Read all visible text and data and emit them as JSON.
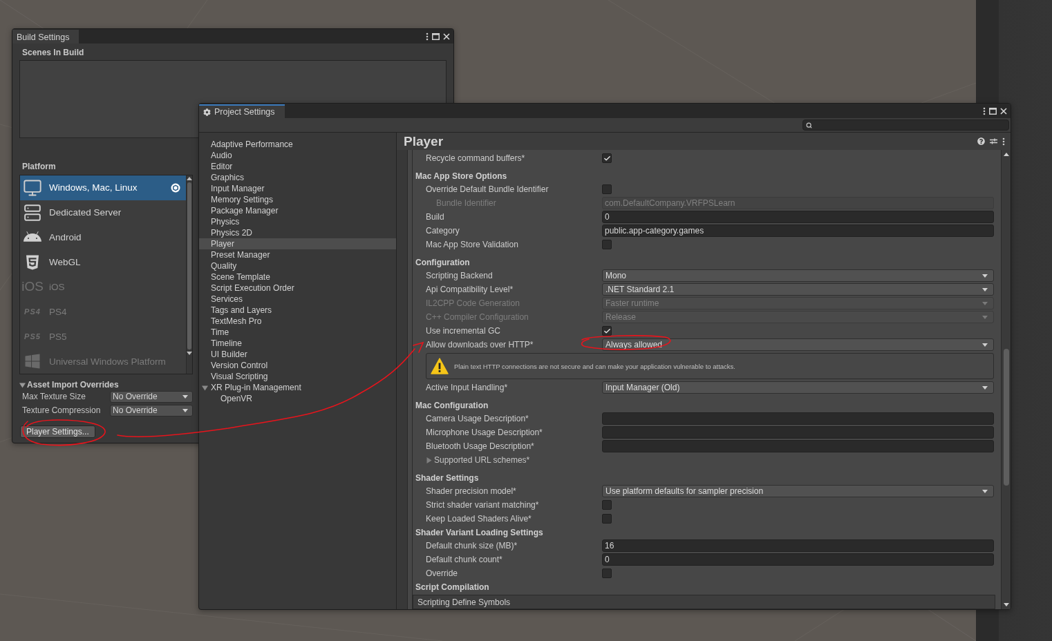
{
  "build_settings": {
    "title": "Build Settings",
    "scenes_label": "Scenes In Build",
    "platform_label": "Platform",
    "platforms": [
      {
        "kind": "desktop",
        "name": "Windows, Mac, Linux",
        "selected": true,
        "disabled": false
      },
      {
        "kind": "server",
        "name": "Dedicated Server",
        "selected": false,
        "disabled": false
      },
      {
        "kind": "android",
        "name": "Android",
        "selected": false,
        "disabled": false
      },
      {
        "kind": "webgl",
        "name": "WebGL",
        "selected": false,
        "disabled": false
      },
      {
        "kind": "ios",
        "logo": "iOS",
        "name": "iOS",
        "selected": false,
        "disabled": true
      },
      {
        "kind": "ps4",
        "logo": "PS4",
        "name": "PS4",
        "selected": false,
        "disabled": true
      },
      {
        "kind": "ps5",
        "logo": "PS5",
        "name": "PS5",
        "selected": false,
        "disabled": true
      },
      {
        "kind": "uwp",
        "name": "Universal Windows Platform",
        "selected": false,
        "disabled": true
      }
    ],
    "asset_import_overrides": {
      "label": "Asset Import Overrides",
      "expanded": true,
      "rows": [
        {
          "label": "Max Texture Size",
          "value": "No Override"
        },
        {
          "label": "Texture Compression",
          "value": "No Override"
        }
      ]
    },
    "player_settings_button": "Player Settings..."
  },
  "project_settings": {
    "title": "Project Settings",
    "nav": [
      {
        "label": "Adaptive Performance",
        "selected": false
      },
      {
        "label": "Audio",
        "selected": false
      },
      {
        "label": "Editor",
        "selected": false
      },
      {
        "label": "Graphics",
        "selected": false
      },
      {
        "label": "Input Manager",
        "selected": false
      },
      {
        "label": "Memory Settings",
        "selected": false
      },
      {
        "label": "Package Manager",
        "selected": false
      },
      {
        "label": "Physics",
        "selected": false
      },
      {
        "label": "Physics 2D",
        "selected": false
      },
      {
        "label": "Player",
        "selected": true
      },
      {
        "label": "Preset Manager",
        "selected": false
      },
      {
        "label": "Quality",
        "selected": false
      },
      {
        "label": "Scene Template",
        "selected": false
      },
      {
        "label": "Script Execution Order",
        "selected": false
      },
      {
        "label": "Services",
        "selected": false
      },
      {
        "label": "Tags and Layers",
        "selected": false
      },
      {
        "label": "TextMesh Pro",
        "selected": false
      },
      {
        "label": "Time",
        "selected": false
      },
      {
        "label": "Timeline",
        "selected": false
      },
      {
        "label": "UI Builder",
        "selected": false
      },
      {
        "label": "Version Control",
        "selected": false
      },
      {
        "label": "Visual Scripting",
        "selected": false
      },
      {
        "label": "XR Plug-in Management",
        "selected": false,
        "expanded": true,
        "children": [
          {
            "label": "OpenVR",
            "selected": false
          }
        ]
      }
    ],
    "panel_title": "Player",
    "rows": [
      {
        "kind": "checkbox",
        "label": "Recycle command buffers*",
        "checked": true
      },
      {
        "kind": "header",
        "label": "Mac App Store Options"
      },
      {
        "kind": "checkbox",
        "label": "Override Default Bundle Identifier",
        "checked": false,
        "children": [
          {
            "kind": "text",
            "label": "Bundle Identifier",
            "value": "com.DefaultCompany.VRFPSLearn",
            "disabled": true
          }
        ]
      },
      {
        "kind": "text",
        "label": "Build",
        "value": "0",
        "disabled": false
      },
      {
        "kind": "text",
        "label": "Category",
        "value": "public.app-category.games",
        "disabled": false
      },
      {
        "kind": "checkbox",
        "label": "Mac App Store Validation",
        "checked": false
      },
      {
        "kind": "header",
        "label": "Configuration"
      },
      {
        "kind": "dropdown",
        "label": "Scripting Backend",
        "value": "Mono",
        "disabled": false
      },
      {
        "kind": "dropdown",
        "label": "Api Compatibility Level*",
        "value": ".NET Standard 2.1",
        "disabled": false
      },
      {
        "kind": "dropdown",
        "label": "IL2CPP Code Generation",
        "value": "Faster runtime",
        "disabled": true
      },
      {
        "kind": "dropdown",
        "label": "C++ Compiler Configuration",
        "value": "Release",
        "disabled": true
      },
      {
        "kind": "checkbox",
        "label": "Use incremental GC",
        "checked": true
      },
      {
        "kind": "dropdown",
        "label": "Allow downloads over HTTP*",
        "value": "Always allowed",
        "disabled": false
      },
      {
        "kind": "warning",
        "text": "Plain text HTTP connections are not secure and can make your application vulnerable to attacks."
      },
      {
        "kind": "dropdown",
        "label": "Active Input Handling*",
        "value": "Input Manager (Old)",
        "disabled": false
      },
      {
        "kind": "header",
        "label": "Mac Configuration"
      },
      {
        "kind": "text",
        "label": "Camera Usage Description*",
        "disabled": false
      },
      {
        "kind": "text",
        "label": "Microphone Usage Description*",
        "disabled": false
      },
      {
        "kind": "text",
        "label": "Bluetooth Usage Description*",
        "disabled": false
      },
      {
        "kind": "foldout",
        "label": "Supported URL schemes*",
        "expanded": false
      },
      {
        "kind": "header",
        "label": "Shader Settings"
      },
      {
        "kind": "dropdown",
        "label": "Shader precision model*",
        "value": "Use platform defaults for sampler precision",
        "disabled": false
      },
      {
        "kind": "checkbox",
        "label": "Strict shader variant matching*",
        "checked": false
      },
      {
        "kind": "checkbox",
        "label": "Keep Loaded Shaders Alive*",
        "checked": false
      },
      {
        "kind": "subheader",
        "label": "Shader Variant Loading Settings"
      },
      {
        "kind": "text",
        "label": "Default chunk size (MB)*",
        "value": "16",
        "disabled": false
      },
      {
        "kind": "text",
        "label": "Default chunk count*",
        "value": "0",
        "disabled": false
      },
      {
        "kind": "checkbox",
        "label": "Override",
        "checked": false
      },
      {
        "kind": "subheader",
        "label": "Script Compilation"
      },
      {
        "kind": "section",
        "label": "Scripting Define Symbols"
      }
    ]
  }
}
